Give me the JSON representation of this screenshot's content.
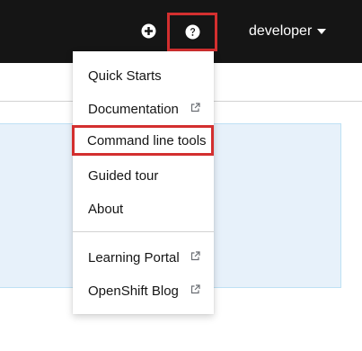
{
  "masthead": {
    "add_icon": "plus-circle-icon",
    "help_icon": "question-circle-icon",
    "username": "developer",
    "caret_icon": "caret-down-icon"
  },
  "help_menu": {
    "items": [
      {
        "label": "Quick Starts",
        "external": false
      },
      {
        "label": "Documentation",
        "external": true
      },
      {
        "label": "Command line tools",
        "external": false,
        "highlighted": true
      },
      {
        "label": "Guided tour",
        "external": false
      },
      {
        "label": "About",
        "external": false
      }
    ],
    "links": [
      {
        "label": "Learning Portal",
        "external": true
      },
      {
        "label": "OpenShift Blog",
        "external": true
      }
    ]
  },
  "colors": {
    "masthead_bg": "#151515",
    "highlight_border": "#d32f2f",
    "info_panel_bg": "#e7f1fa"
  }
}
